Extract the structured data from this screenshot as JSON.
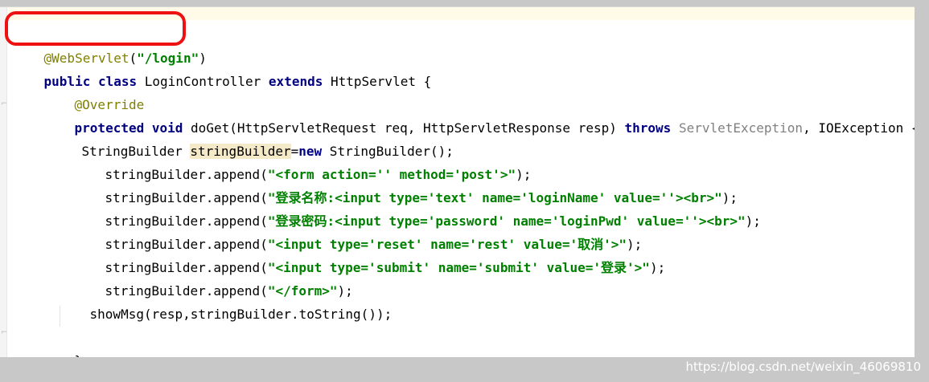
{
  "editor": {
    "lines": [
      {
        "text": ""
      },
      {
        "text": "@WebServlet(\"/login\")"
      },
      {
        "text": "public class LoginController extends HttpServlet {"
      },
      {
        "text": "@Override"
      },
      {
        "text": "protected void doGet(HttpServletRequest req, HttpServletResponse resp) throws ServletException, IOException {"
      },
      {
        "text": "StringBuilder stringBuilder=new StringBuilder();"
      },
      {
        "text": "stringBuilder.append(\"<form action='' method='post'>\");"
      },
      {
        "text": "stringBuilder.append(\"登录名称:<input type='text' name='loginName' value=''><br>\");"
      },
      {
        "text": "stringBuilder.append(\"登录密码:<input type='password' name='loginPwd' value=''><br>\");"
      },
      {
        "text": "stringBuilder.append(\"<input type='reset' name='rest' value='取消'>\");"
      },
      {
        "text": "stringBuilder.append(\"<input type='submit' name='submit' value='登录'>\");"
      },
      {
        "text": "stringBuilder.append(\"</form>\");"
      },
      {
        "text": "showMsg(resp,stringBuilder.toString());"
      },
      {
        "text": ""
      },
      {
        "text": "}"
      }
    ],
    "tokens": {
      "l1": {
        "annotation": "@WebServlet",
        "paren_open": "(",
        "string": "\"/login\"",
        "paren_close": ")"
      },
      "l2": {
        "kw1": "public",
        "kw2": "class",
        "name": "LoginController",
        "kw3": "extends",
        "base": "HttpServlet {"
      },
      "l3": {
        "annotation": "@Override"
      },
      "l4": {
        "kw1": "protected",
        "kw2": "void",
        "sig": "doGet(HttpServletRequest req, HttpServletResponse resp)",
        "kw3": "throws",
        "ex1": "ServletException",
        "ex2": ", IOException {"
      },
      "l5": {
        "type": "StringBuilder ",
        "var": "stringBuilder",
        "eq": "=",
        "kw": "new",
        "rest": " StringBuilder();"
      },
      "l6": {
        "pre": "stringBuilder.append(",
        "str": "\"<form action='' method='post'>\"",
        "post": ");"
      },
      "l7": {
        "pre": "stringBuilder.append(",
        "str": "\"登录名称:<input type='text' name='loginName' value=''><br>\"",
        "post": ");"
      },
      "l8": {
        "pre": "stringBuilder.append(",
        "str": "\"登录密码:<input type='password' name='loginPwd' value=''><br>\"",
        "post": ");"
      },
      "l9": {
        "pre": "stringBuilder.append(",
        "str": "\"<input type='reset' name='rest' value='取消'>\"",
        "post": ");"
      },
      "l10": {
        "pre": "stringBuilder.append(",
        "str": "\"<input type='submit' name='submit' value='登录'>\"",
        "post": ");"
      },
      "l11": {
        "pre": "stringBuilder.append(",
        "str": "\"</form>\"",
        "post": ");"
      },
      "l12": {
        "text": "showMsg(resp,stringBuilder.toString());"
      },
      "l14": {
        "text": "}"
      }
    }
  },
  "colors": {
    "annotation": "#808000",
    "keyword": "#000080",
    "string": "#008000",
    "gray_type": "#808080",
    "highlight": "#f5eac8",
    "red_box": "#ef1111",
    "background": "#c8c8c8"
  },
  "watermark": {
    "text": "https://blog.csdn.net/weixin_46069810"
  }
}
